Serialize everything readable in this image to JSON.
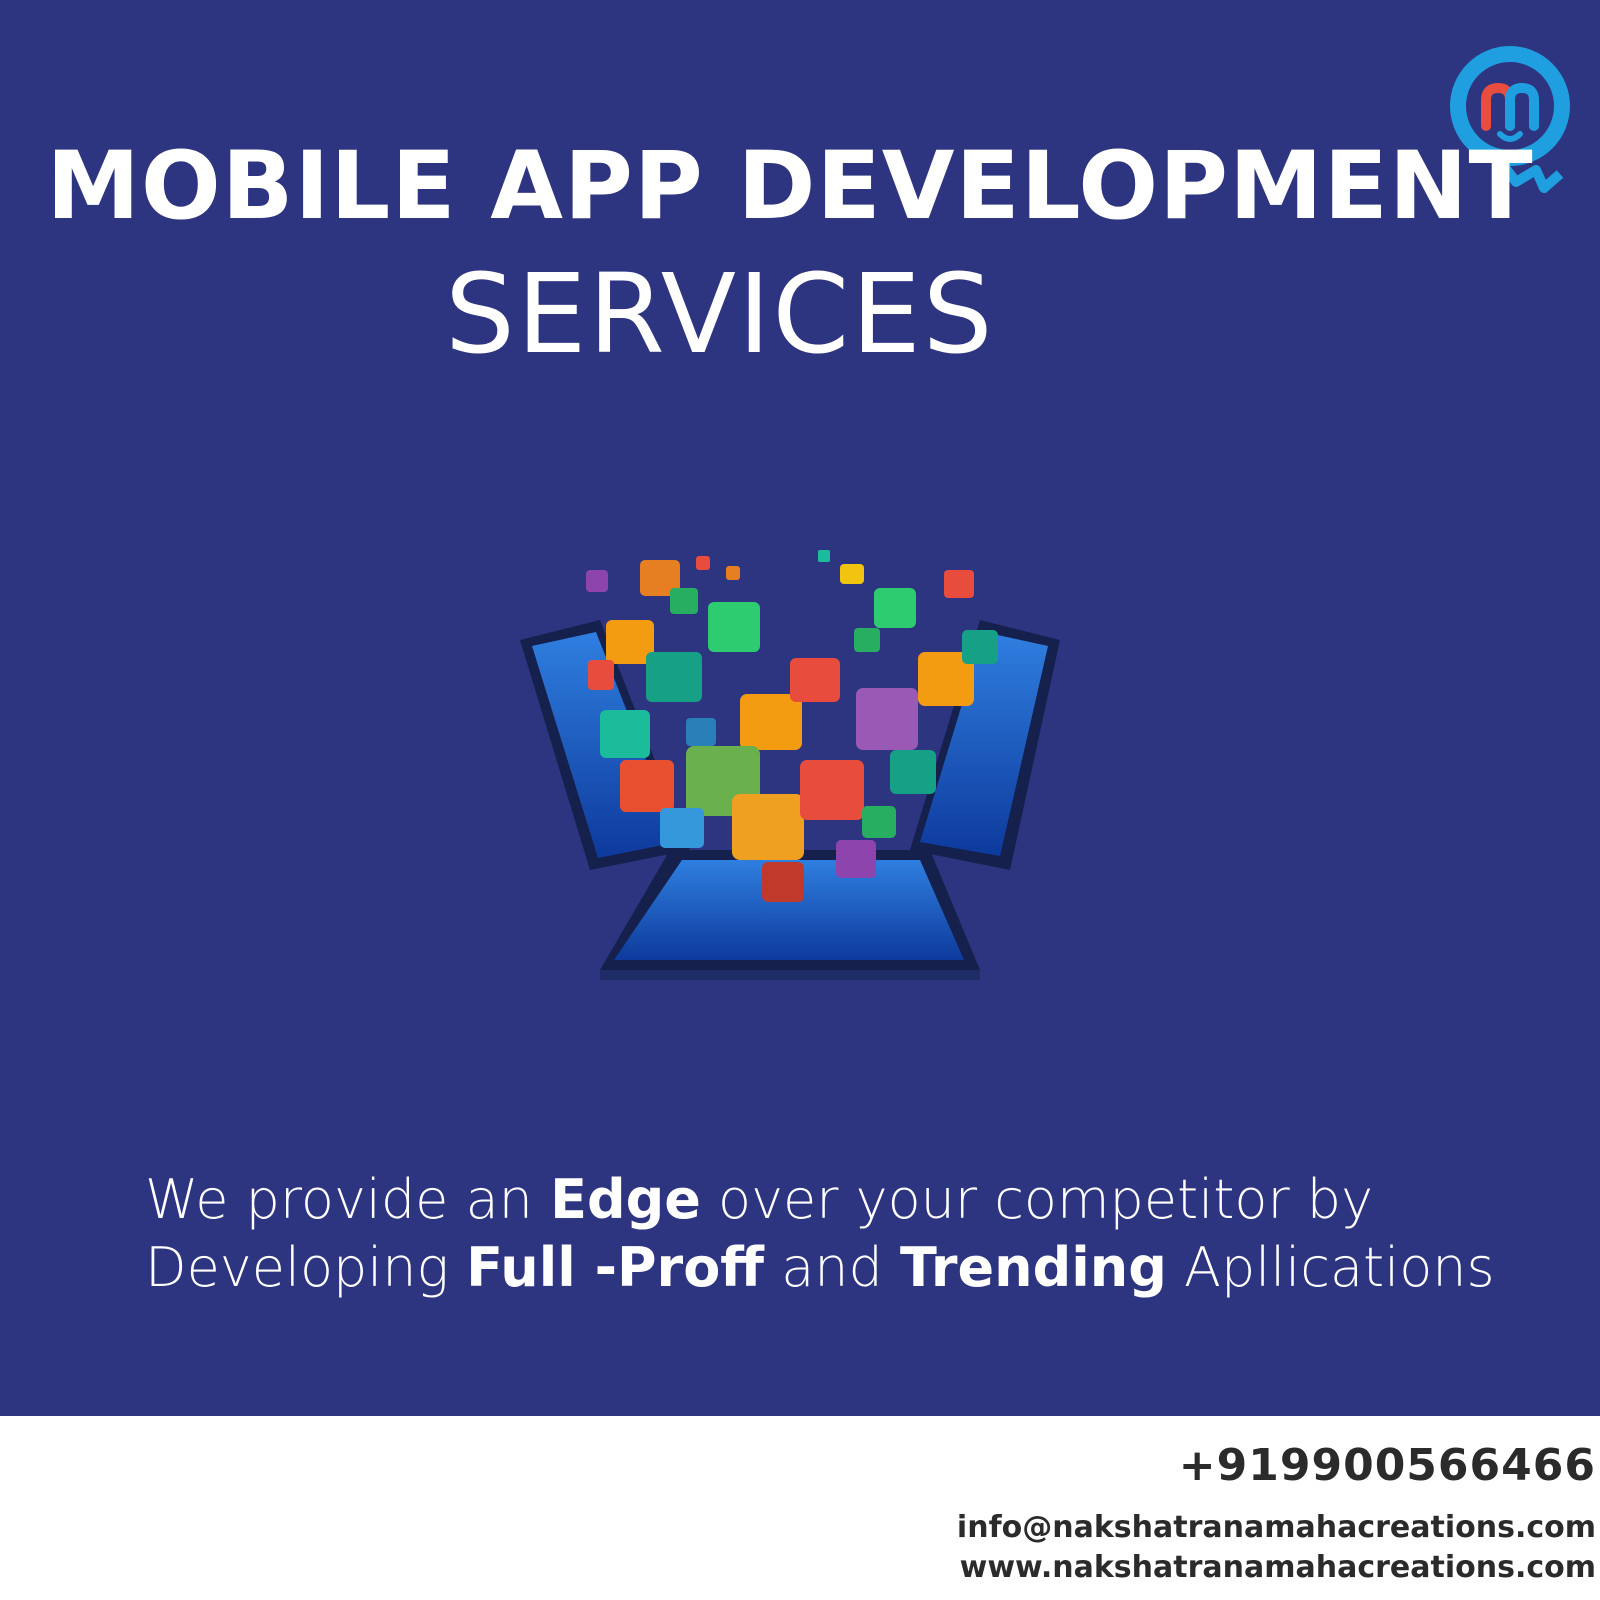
{
  "headline": {
    "line1": "MOBILE APP DEVELOPMENT",
    "line2": "SERVICES"
  },
  "tagline": {
    "line1_a": "We provide an ",
    "line1_bold": "Edge",
    "line1_b": " over your competitor by",
    "line2_a": "Developing ",
    "line2_bold1": "Full -Proff",
    "line2_b": " and ",
    "line2_bold2": "Trending",
    "line2_c": " Apllications"
  },
  "contact": {
    "phone": "+919900566466",
    "email": "info@nakshatranamahacreations.com",
    "website": "www.nakshatranamahacreations.com"
  },
  "colors": {
    "background": "#2d3480",
    "footer": "#ffffff",
    "logo": "#1f9fe0"
  },
  "icons": [
    "logo",
    "phones-illustration",
    "app-icons"
  ]
}
